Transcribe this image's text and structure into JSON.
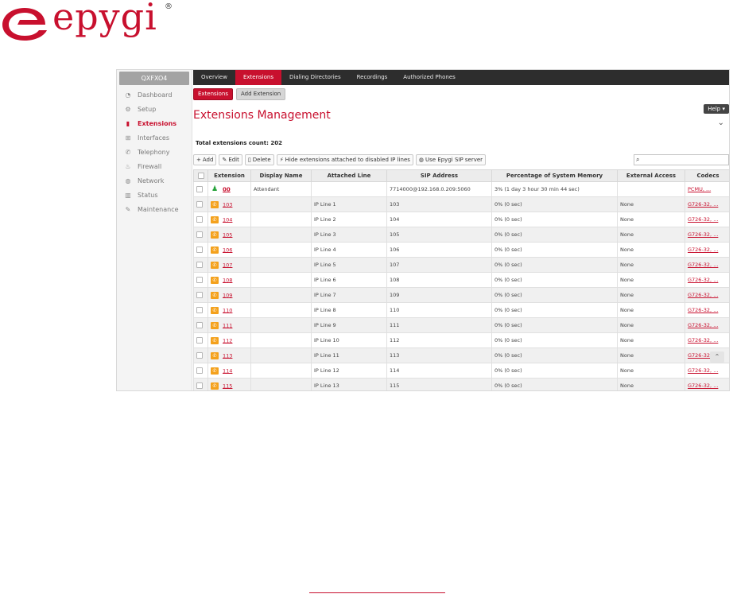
{
  "brand": {
    "name": "epygi",
    "registered": "®",
    "accent_color": "#c8102e"
  },
  "sidebar": {
    "device": "QXFXO4",
    "items": [
      {
        "label": "Dashboard",
        "icon": "dashboard-icon"
      },
      {
        "label": "Setup",
        "icon": "gear-icon"
      },
      {
        "label": "Extensions",
        "icon": "book-icon",
        "active": true
      },
      {
        "label": "Interfaces",
        "icon": "network-node-icon"
      },
      {
        "label": "Telephony",
        "icon": "phone-icon"
      },
      {
        "label": "Firewall",
        "icon": "flame-icon"
      },
      {
        "label": "Network",
        "icon": "globe-icon"
      },
      {
        "label": "Status",
        "icon": "bar-chart-icon"
      },
      {
        "label": "Maintenance",
        "icon": "wrench-icon"
      }
    ]
  },
  "topnav": {
    "tabs": [
      {
        "label": "Overview"
      },
      {
        "label": "Extensions",
        "active": true
      },
      {
        "label": "Dialing Directories"
      },
      {
        "label": "Recordings"
      },
      {
        "label": "Authorized Phones"
      }
    ]
  },
  "subtabs": [
    {
      "label": "Extensions",
      "active": true
    },
    {
      "label": "Add Extension"
    }
  ],
  "help_label": "Help",
  "page_title": "Extensions Management",
  "total_count": "Total extensions count: 202",
  "toolbar": {
    "add": "Add",
    "edit": "Edit",
    "delete": "Delete",
    "hide": "Hide extensions attached to disabled IP lines",
    "use_sip": "Use Epygi SIP server"
  },
  "search": {
    "value": "",
    "placeholder": ""
  },
  "table": {
    "columns": [
      "Extension",
      "Display Name",
      "Attached Line",
      "SIP Address",
      "Percentage of System Memory",
      "External Access",
      "Codecs"
    ],
    "rows": [
      {
        "ext": "00",
        "type": "attendant",
        "display": "Attendant",
        "line": "",
        "sip": "7714000@192.168.0.209:5060",
        "memory": "3% (1 day 3 hour 30 min 44 sec)",
        "access": "",
        "codecs": "PCMU, ..."
      },
      {
        "ext": "103",
        "type": "phone",
        "display": "",
        "line": "IP Line 1",
        "sip": "103",
        "memory": "0% (0 sec)",
        "access": "None",
        "codecs": "G726-32, ..."
      },
      {
        "ext": "104",
        "type": "phone",
        "display": "",
        "line": "IP Line 2",
        "sip": "104",
        "memory": "0% (0 sec)",
        "access": "None",
        "codecs": "G726-32, ..."
      },
      {
        "ext": "105",
        "type": "phone",
        "display": "",
        "line": "IP Line 3",
        "sip": "105",
        "memory": "0% (0 sec)",
        "access": "None",
        "codecs": "G726-32, ..."
      },
      {
        "ext": "106",
        "type": "phone",
        "display": "",
        "line": "IP Line 4",
        "sip": "106",
        "memory": "0% (0 sec)",
        "access": "None",
        "codecs": "G726-32, ..."
      },
      {
        "ext": "107",
        "type": "phone",
        "display": "",
        "line": "IP Line 5",
        "sip": "107",
        "memory": "0% (0 sec)",
        "access": "None",
        "codecs": "G726-32, ..."
      },
      {
        "ext": "108",
        "type": "phone",
        "display": "",
        "line": "IP Line 6",
        "sip": "108",
        "memory": "0% (0 sec)",
        "access": "None",
        "codecs": "G726-32, ..."
      },
      {
        "ext": "109",
        "type": "phone",
        "display": "",
        "line": "IP Line 7",
        "sip": "109",
        "memory": "0% (0 sec)",
        "access": "None",
        "codecs": "G726-32, ..."
      },
      {
        "ext": "110",
        "type": "phone",
        "display": "",
        "line": "IP Line 8",
        "sip": "110",
        "memory": "0% (0 sec)",
        "access": "None",
        "codecs": "G726-32, ..."
      },
      {
        "ext": "111",
        "type": "phone",
        "display": "",
        "line": "IP Line 9",
        "sip": "111",
        "memory": "0% (0 sec)",
        "access": "None",
        "codecs": "G726-32, ..."
      },
      {
        "ext": "112",
        "type": "phone",
        "display": "",
        "line": "IP Line 10",
        "sip": "112",
        "memory": "0% (0 sec)",
        "access": "None",
        "codecs": "G726-32, ..."
      },
      {
        "ext": "113",
        "type": "phone",
        "display": "",
        "line": "IP Line 11",
        "sip": "113",
        "memory": "0% (0 sec)",
        "access": "None",
        "codecs": "G726-32, ..."
      },
      {
        "ext": "114",
        "type": "phone",
        "display": "",
        "line": "IP Line 12",
        "sip": "114",
        "memory": "0% (0 sec)",
        "access": "None",
        "codecs": "G726-32, ..."
      },
      {
        "ext": "115",
        "type": "phone",
        "display": "",
        "line": "IP Line 13",
        "sip": "115",
        "memory": "0% (0 sec)",
        "access": "None",
        "codecs": "G726-32, ..."
      }
    ]
  }
}
